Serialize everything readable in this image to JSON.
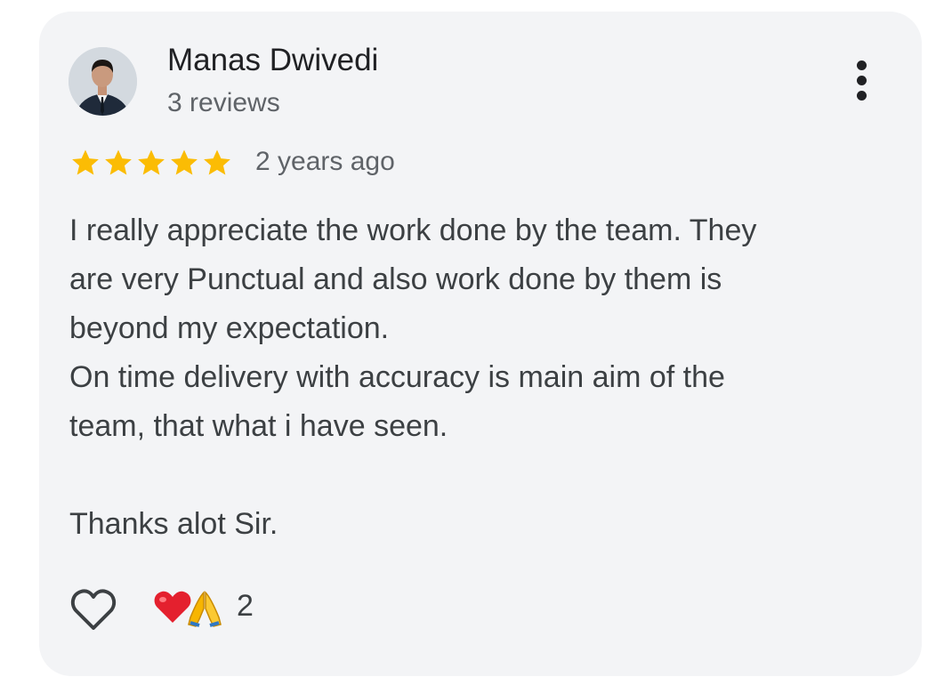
{
  "reviewer": {
    "name": "Manas Dwivedi",
    "reviews_count": "3 reviews"
  },
  "rating": {
    "stars": 5,
    "max": 5,
    "color": "#fbbc04"
  },
  "review": {
    "date": "2 years ago",
    "lines": [
      "I really appreciate the work done by the team. They",
      "are very Punctual and also work done by them is",
      "beyond my expectation.",
      "On time delivery with accuracy is main aim of the",
      "team, that what i have seen.",
      "",
      "Thanks alot Sir."
    ]
  },
  "reactions": {
    "like_icon": "heart-outline-icon",
    "emoji_icons": [
      "red-heart-emoji",
      "folded-hands-emoji"
    ],
    "count": "2"
  },
  "menu": {
    "icon": "more-vertical-icon"
  }
}
